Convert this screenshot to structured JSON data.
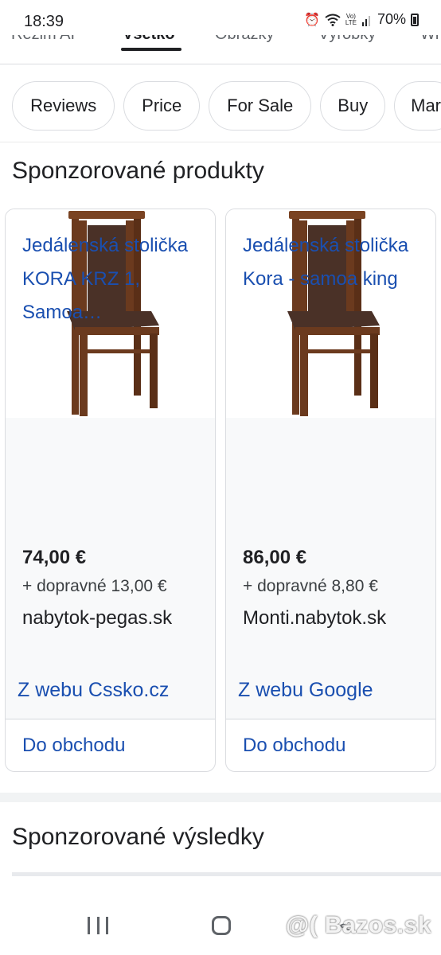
{
  "status_bar": {
    "time": "18:39",
    "battery": "70%",
    "icons": [
      "alarm-icon",
      "wifi-icon",
      "volte-icon",
      "signal-icon",
      "battery-icon"
    ]
  },
  "top_tabs": {
    "items": [
      "Režim AI",
      "Všetko",
      "Obrázky",
      "Výrobky",
      "Wi"
    ],
    "active": "Všetko"
  },
  "chips": [
    "Reviews",
    "Price",
    "For Sale",
    "Buy",
    "Mar"
  ],
  "sponsored_products": {
    "title": "Sponzorované produkty",
    "cards": [
      {
        "title": "Jedálenská stolička KORA KRZ 1, Samoa…",
        "price": "74,00 €",
        "shipping": "+ dopravné 13,00 €",
        "store": "nabytok-pegas.sk",
        "source": "Z webu Cssko.cz",
        "cta": "Do obchodu"
      },
      {
        "title": "Jedálenská stolička Kora - samoa king",
        "price": "86,00 €",
        "shipping": "+ dopravné 8,80 €",
        "store": "Monti.nabytok.sk",
        "source": "Z webu Google",
        "cta": "Do obchodu"
      }
    ]
  },
  "sponsored_results": {
    "title": "Sponzorované výsledky"
  },
  "watermark": "@( Bazos.sk",
  "colors": {
    "link_blue": "#1a4fb0",
    "chair_wood": "#6b3a1e",
    "chair_fabric": "#4a3127"
  }
}
